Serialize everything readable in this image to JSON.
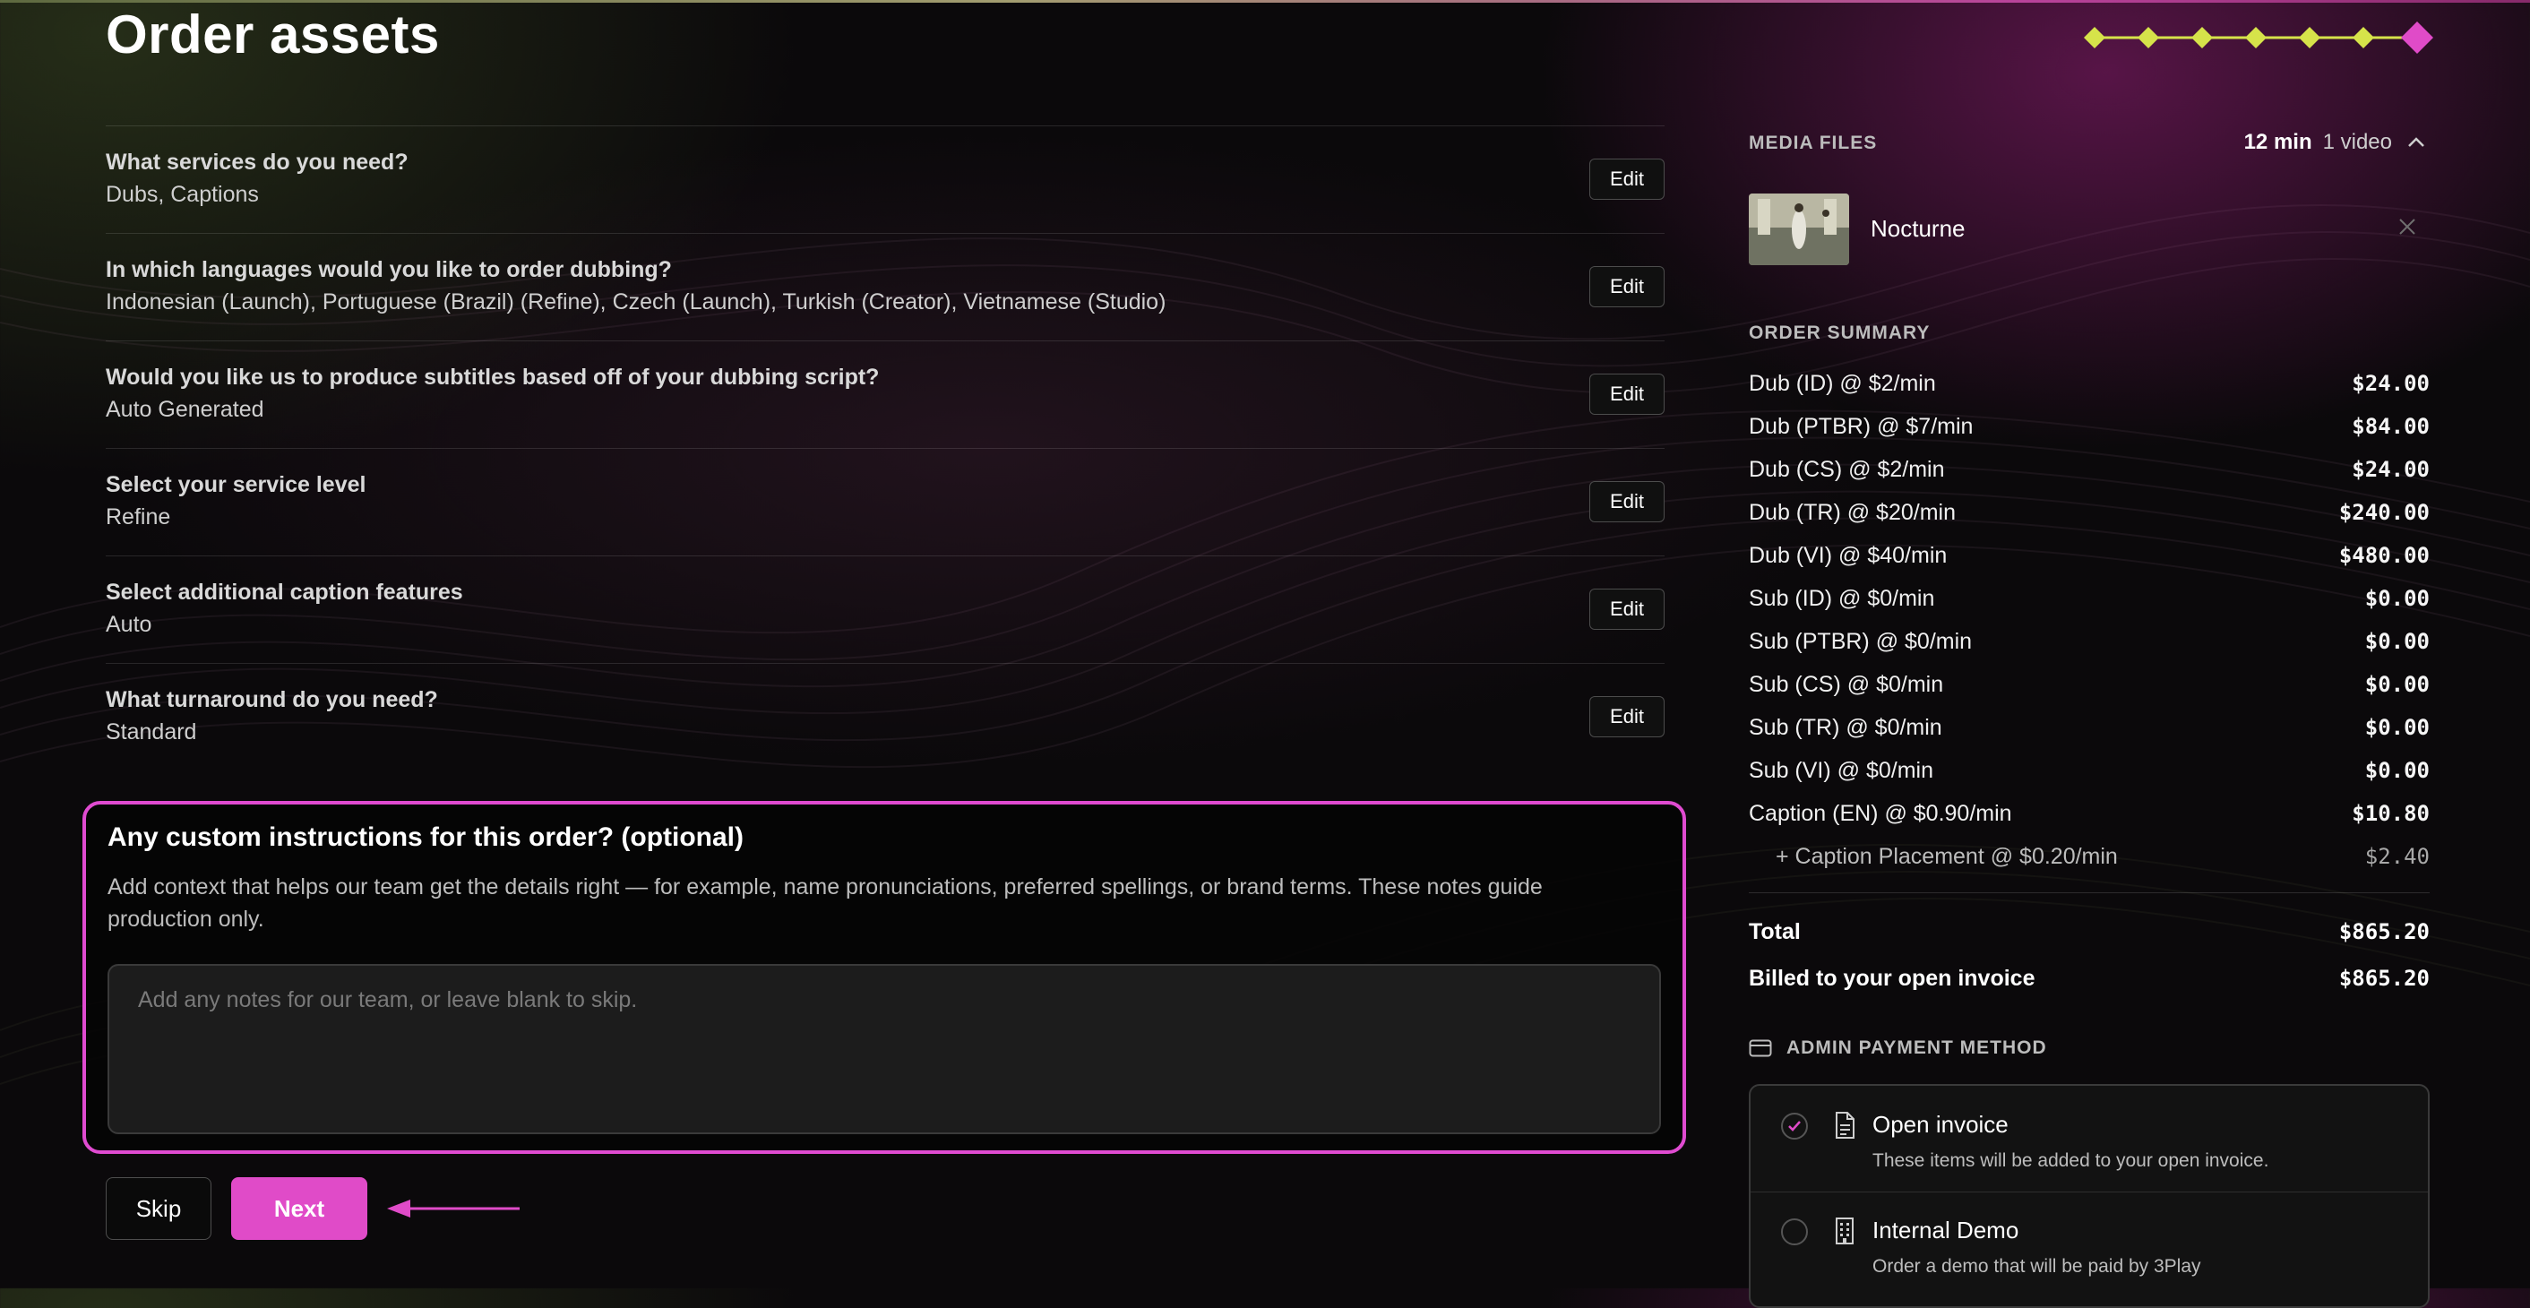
{
  "page": {
    "title": "Order assets"
  },
  "progress": {
    "total_steps": 7,
    "current_step": 7
  },
  "questions": [
    {
      "question": "What services do you need?",
      "answer": "Dubs, Captions",
      "edit_label": "Edit"
    },
    {
      "question": "In which languages would you like to order dubbing?",
      "answer": "Indonesian (Launch), Portuguese (Brazil) (Refine), Czech (Launch), Turkish (Creator), Vietnamese (Studio)",
      "edit_label": "Edit"
    },
    {
      "question": "Would you like us to produce subtitles based off of your dubbing script?",
      "answer": "Auto Generated",
      "edit_label": "Edit"
    },
    {
      "question": "Select your service level",
      "answer": "Refine",
      "edit_label": "Edit"
    },
    {
      "question": "Select additional caption features",
      "answer": "Auto",
      "edit_label": "Edit"
    },
    {
      "question": "What turnaround do you need?",
      "answer": "Standard",
      "edit_label": "Edit"
    }
  ],
  "custom_instructions": {
    "title": "Any custom instructions for this order? (optional)",
    "description": "Add context that helps our team get the details right — for example, name pronunciations, preferred spellings, or brand terms. These notes guide production only.",
    "placeholder": "Add any notes for our team, or leave blank to skip.",
    "value": ""
  },
  "actions": {
    "skip_label": "Skip",
    "next_label": "Next"
  },
  "media_files": {
    "label": "MEDIA FILES",
    "duration": "12 min",
    "count": "1 video",
    "items": [
      {
        "name": "Nocturne"
      }
    ]
  },
  "order_summary": {
    "label": "ORDER SUMMARY",
    "lines": [
      {
        "label": "Dub (ID) @ $2/min",
        "amount": "$24.00"
      },
      {
        "label": "Dub (PTBR) @ $7/min",
        "amount": "$84.00"
      },
      {
        "label": "Dub (CS) @ $2/min",
        "amount": "$24.00"
      },
      {
        "label": "Dub (TR) @ $20/min",
        "amount": "$240.00"
      },
      {
        "label": "Dub (VI) @ $40/min",
        "amount": "$480.00"
      },
      {
        "label": "Sub (ID) @ $0/min",
        "amount": "$0.00"
      },
      {
        "label": "Sub (PTBR) @ $0/min",
        "amount": "$0.00"
      },
      {
        "label": "Sub (CS) @ $0/min",
        "amount": "$0.00"
      },
      {
        "label": "Sub (TR) @ $0/min",
        "amount": "$0.00"
      },
      {
        "label": "Sub (VI) @ $0/min",
        "amount": "$0.00"
      },
      {
        "label": "Caption (EN) @ $0.90/min",
        "amount": "$10.80"
      },
      {
        "label": "+ Caption Placement @ $0.20/min",
        "amount": "$2.40"
      }
    ],
    "total_label": "Total",
    "total_amount": "$865.20",
    "billed_label": "Billed to your open invoice",
    "billed_amount": "$865.20"
  },
  "payment_method": {
    "label": "ADMIN PAYMENT METHOD",
    "options": [
      {
        "title": "Open invoice",
        "description": "These items will be added to your open invoice.",
        "selected": true,
        "icon": "document-icon"
      },
      {
        "title": "Internal Demo",
        "description": "Order a demo that will be paid by 3Play",
        "selected": false,
        "icon": "building-icon"
      }
    ]
  },
  "colors": {
    "accent": "#e04bc8",
    "progress_done": "#d6e34a",
    "background": "#0b090b"
  }
}
